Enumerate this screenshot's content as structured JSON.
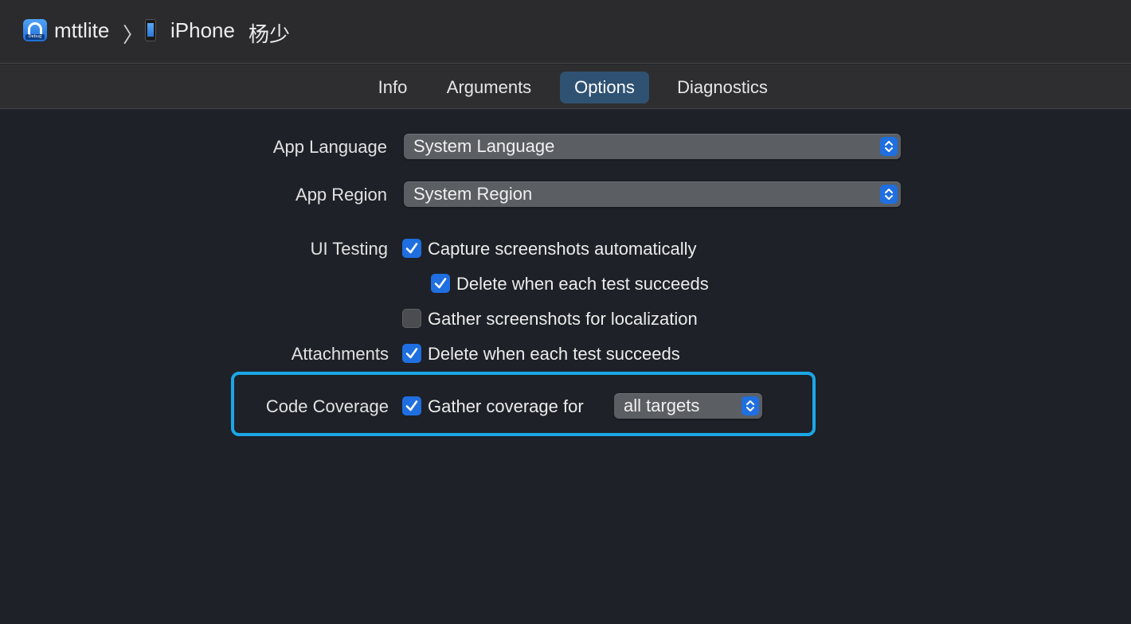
{
  "breadcrumb": {
    "scheme": "mttlite",
    "scheme_icon_badge": "Debug",
    "separator": "〉",
    "destination": "iPhone",
    "device_name": "杨少"
  },
  "tabs": [
    {
      "label": "Info",
      "selected": false
    },
    {
      "label": "Arguments",
      "selected": false
    },
    {
      "label": "Options",
      "selected": true
    },
    {
      "label": "Diagnostics",
      "selected": false
    }
  ],
  "form": {
    "app_language": {
      "label": "App Language",
      "value": "System Language"
    },
    "app_region": {
      "label": "App Region",
      "value": "System Region"
    },
    "ui_testing": {
      "label": "UI Testing",
      "capture_screenshots": {
        "label": "Capture screenshots automatically",
        "checked": true
      },
      "delete_on_success": {
        "label": "Delete when each test succeeds",
        "checked": true
      },
      "gather_localization": {
        "label": "Gather screenshots for localization",
        "checked": false
      }
    },
    "attachments": {
      "label": "Attachments",
      "delete_on_success": {
        "label": "Delete when each test succeeds",
        "checked": true
      }
    },
    "code_coverage": {
      "label": "Code Coverage",
      "gather": {
        "label": "Gather coverage for",
        "checked": true
      },
      "targets": {
        "value": "all targets"
      }
    }
  },
  "colors": {
    "accent": "#1f6fe0",
    "selected_tab": "#2f5273",
    "highlight_border": "#1ba7e6",
    "background": "#1e2128"
  },
  "icons": {
    "scheme": "app-icon",
    "device": "iphone-icon",
    "checkbox": "checkmark-icon",
    "popup": "up-down-chevron-icon"
  }
}
